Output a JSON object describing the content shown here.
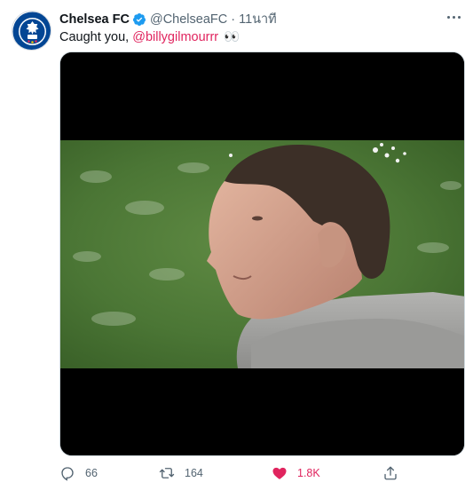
{
  "colors": {
    "accent_pink": "#e0245e",
    "verified_blue": "#1d9bf0",
    "muted_text": "#536471",
    "chelsea_blue": "#034694"
  },
  "tweet": {
    "author": {
      "name": "Chelsea FC",
      "handle": "@ChelseaFC",
      "verified": true,
      "avatar_icon": "chelsea-crest-icon"
    },
    "separator": "·",
    "time": "11นาที",
    "text": {
      "prefix": "Caught you, ",
      "mention": "@billygilmourrr",
      "emoji": "👀"
    },
    "media": {
      "type": "video",
      "icon": "video-frame"
    },
    "actions": {
      "reply": {
        "icon": "reply-icon",
        "count": "66"
      },
      "retweet": {
        "icon": "retweet-icon",
        "count": "164"
      },
      "like": {
        "icon": "heart-icon",
        "count": "1.8K",
        "liked": true
      },
      "share": {
        "icon": "share-icon"
      }
    }
  }
}
